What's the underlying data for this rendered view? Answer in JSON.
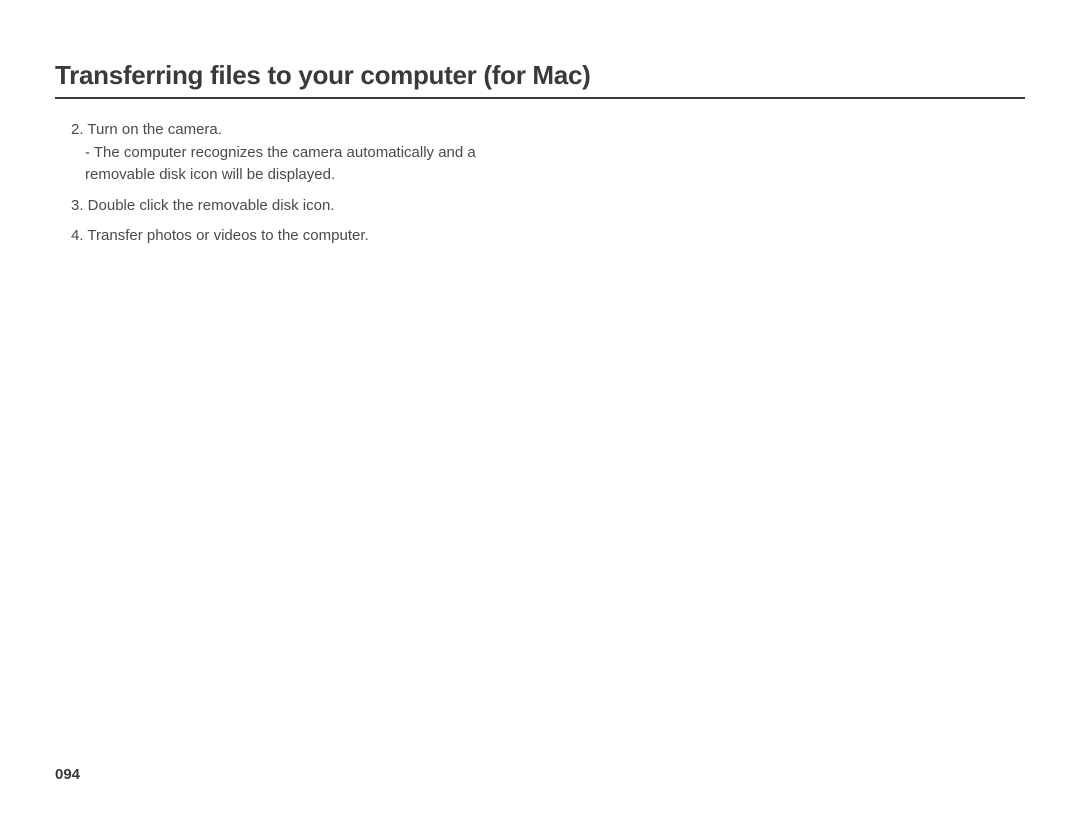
{
  "title": "Transferring files to your computer (for Mac)",
  "steps": {
    "s2_main": "2. Turn on the camera.",
    "s2_sub1": "- The computer recognizes the camera automatically and a",
    "s2_sub2": "removable disk icon will be displayed.",
    "s3": "3. Double click the removable disk icon.",
    "s4": "4. Transfer photos or videos to the computer."
  },
  "page_number": "094"
}
